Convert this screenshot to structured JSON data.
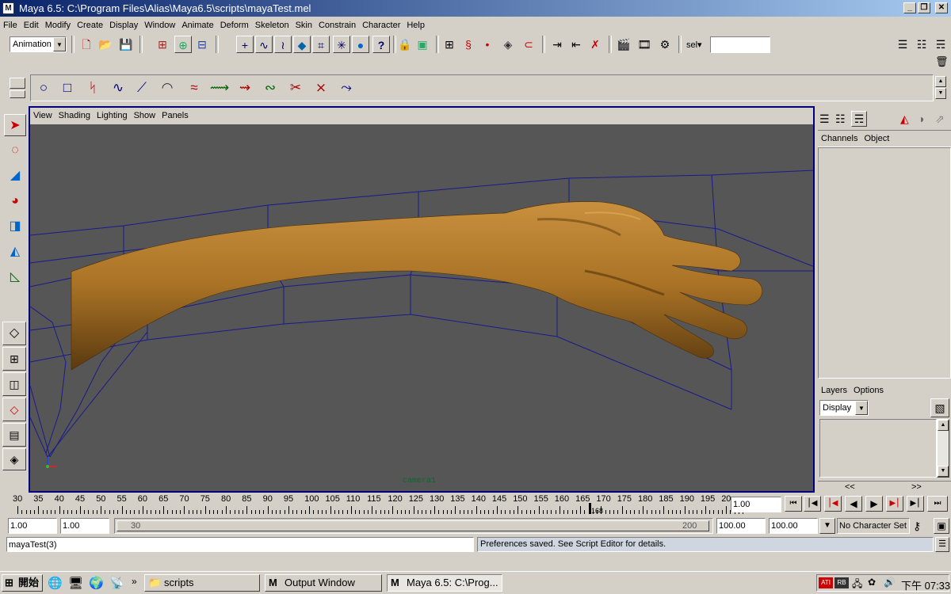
{
  "window": {
    "title": "Maya 6.5: C:\\Program Files\\Alias\\Maya6.5\\scripts\\mayaTest.mel",
    "app_icon_text": "M"
  },
  "menus": [
    "File",
    "Edit",
    "Modify",
    "Create",
    "Display",
    "Window",
    "Animate",
    "Deform",
    "Skeleton",
    "Skin",
    "Constrain",
    "Character",
    "Help"
  ],
  "status_line": {
    "menu_set": "Animation",
    "sel_label": "sel▾",
    "sel_value": ""
  },
  "panel_menus": [
    "View",
    "Shading",
    "Lighting",
    "Show",
    "Panels"
  ],
  "viewport": {
    "camera_label": "camera1"
  },
  "channel_box": {
    "menus": [
      "Channels",
      "Object"
    ]
  },
  "layer_editor": {
    "menus": [
      "Layers",
      "Options"
    ],
    "display_value": "Display",
    "left_arrows": "<<",
    "right_arrows": ">>"
  },
  "time_slider": {
    "ticks": [
      "30",
      "35",
      "40",
      "45",
      "50",
      "55",
      "60",
      "65",
      "70",
      "75",
      "80",
      "85",
      "90",
      "95",
      "100",
      "105",
      "110",
      "115",
      "120",
      "125",
      "130",
      "135",
      "140",
      "145",
      "150",
      "155",
      "160",
      "165",
      "170",
      "175",
      "180",
      "185",
      "190",
      "195",
      "20"
    ],
    "current_frame_marker": "168",
    "current_time": "1.00"
  },
  "range_slider": {
    "start_time": "1.00",
    "playback_start": "1.00",
    "range_start_label": "30",
    "range_end_label": "200",
    "playback_end": "100.00",
    "end_time": "100.00",
    "character_set": "No Character Set"
  },
  "command_line": {
    "input": "mayaTest(3)",
    "feedback": "Preferences saved. See Script Editor for details."
  },
  "taskbar": {
    "start_label": "開始",
    "tasks": [
      "scripts",
      "Output Window",
      "Maya 6.5: C:\\Prog..."
    ],
    "clock": "下午 07:33"
  }
}
